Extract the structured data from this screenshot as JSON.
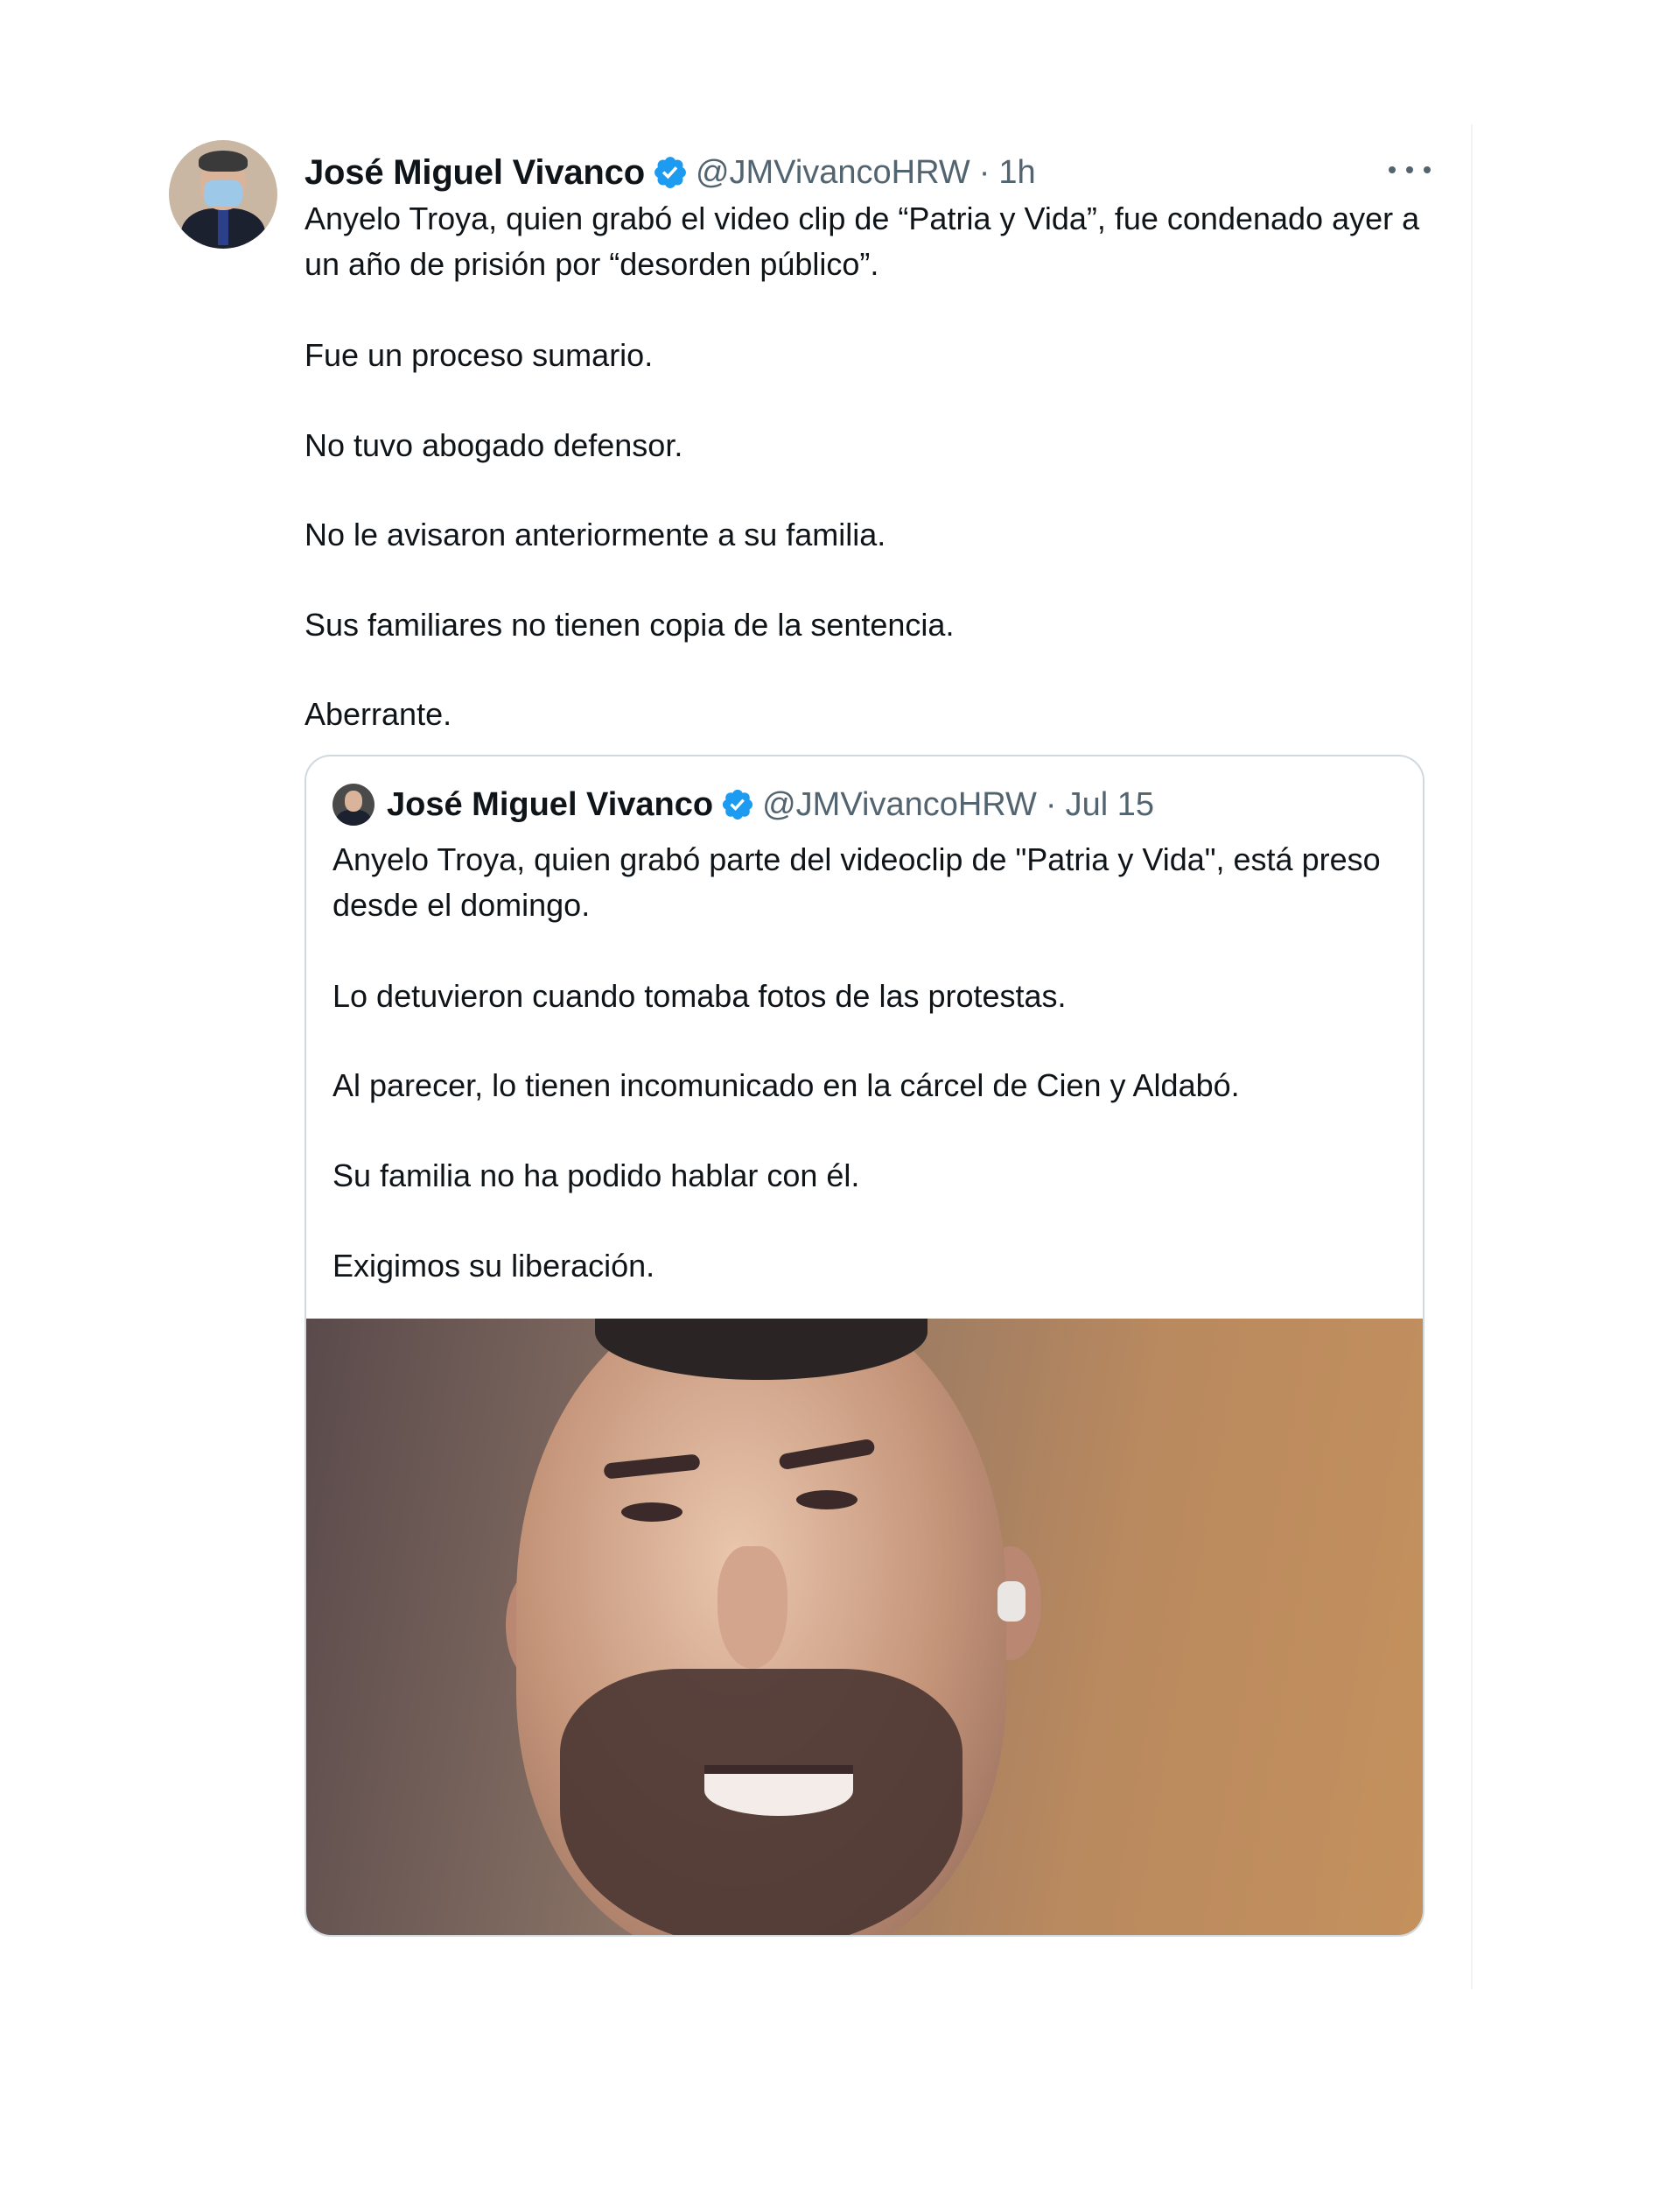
{
  "tweet": {
    "author_name": "José Miguel Vivanco",
    "handle": "@JMVivancoHRW",
    "separator": "·",
    "time": "1h",
    "icons": {
      "verified": "verified-badge-icon",
      "more": "more-options-icon"
    },
    "paragraphs": [
      "Anyelo Troya, quien grabó el video clip de “Patria y Vida”, fue condenado ayer a un año de prisión por “desorden público”.",
      "Fue un proceso sumario.",
      "No tuvo abogado defensor.",
      "No le avisaron anteriormente a su familia.",
      "Sus familiares no tienen copia de la sentencia.",
      "Aberrante."
    ]
  },
  "quoted": {
    "author_name": "José Miguel Vivanco",
    "handle": "@JMVivancoHRW",
    "separator": "·",
    "time": "Jul 15",
    "paragraphs": [
      "Anyelo Troya, quien grabó parte del videoclip de \"Patria y Vida\", está preso desde el domingo.",
      "Lo detuvieron cuando tomaba fotos de las protestas.",
      "Al parecer, lo tienen incomunicado en la cárcel de Cien y Aldabó.",
      "Su familia no ha podido hablar con él.",
      "Exigimos su liberación."
    ]
  },
  "colors": {
    "verified": "#1d9bf0",
    "secondary_text": "#536471",
    "border": "#cfd9de"
  }
}
